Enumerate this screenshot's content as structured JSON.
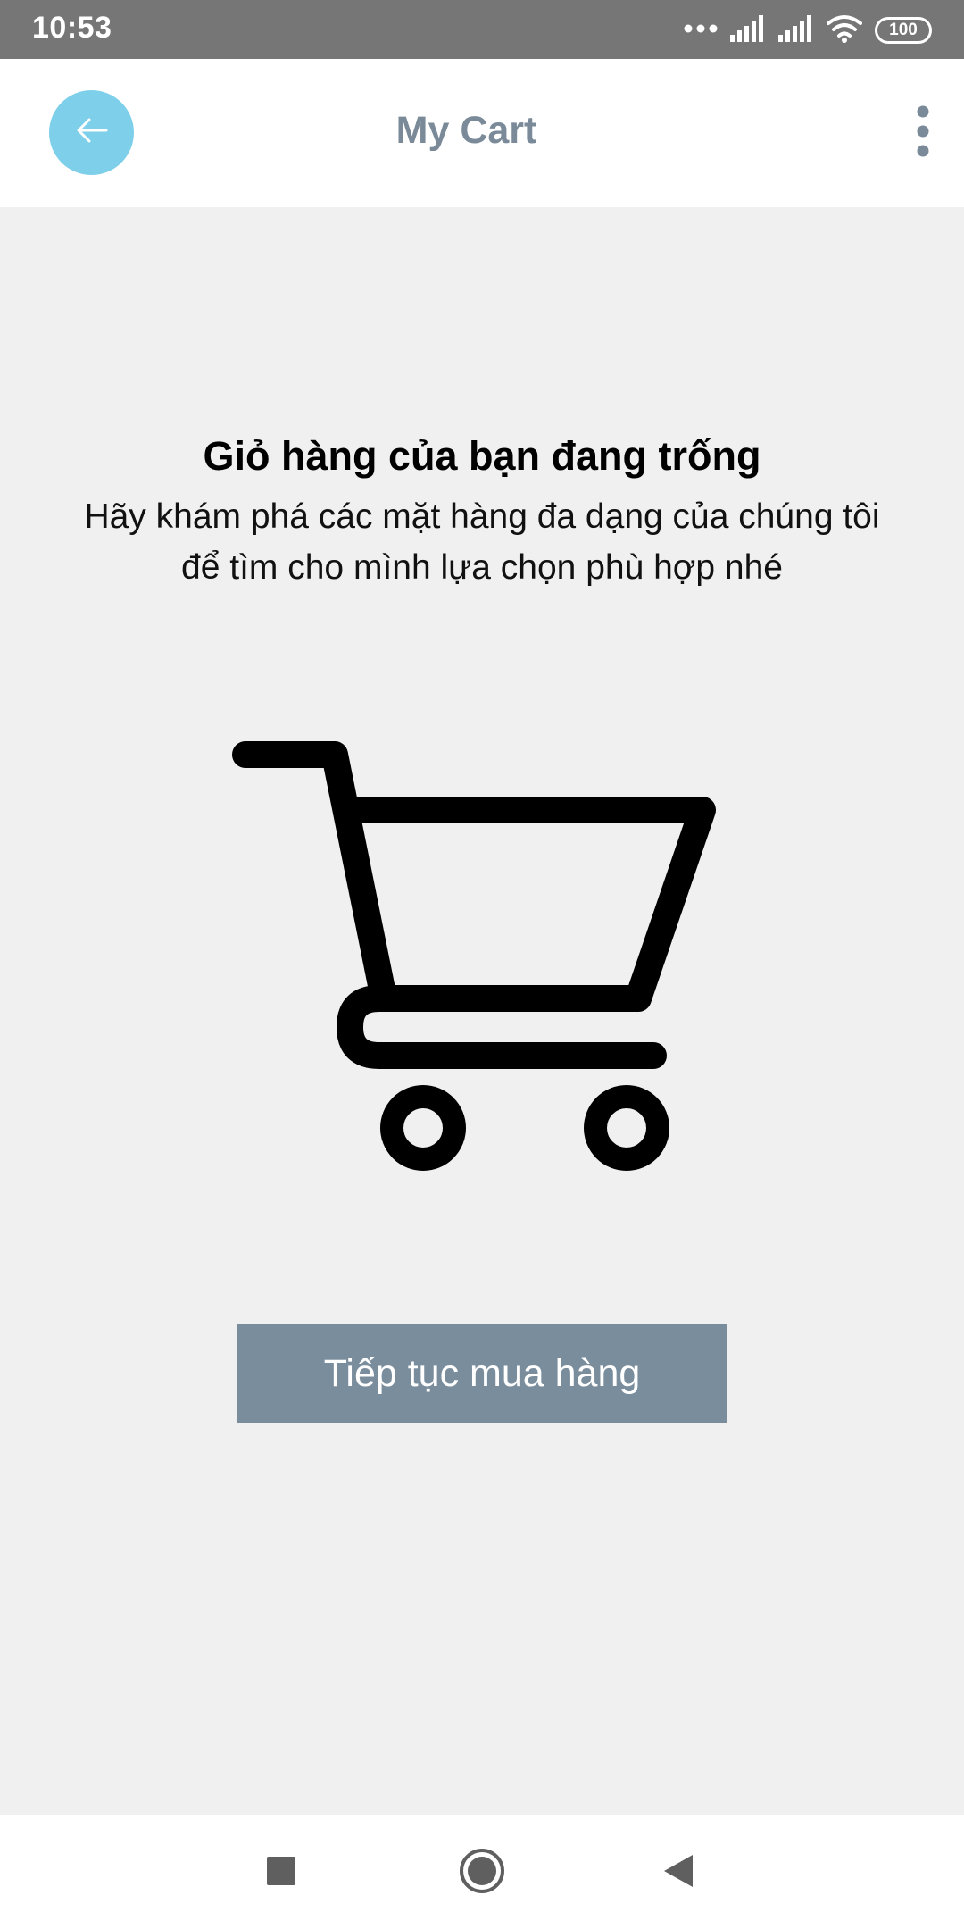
{
  "status_bar": {
    "time": "10:53",
    "battery": "100",
    "icons": [
      "dots-icon",
      "signal-icon",
      "signal-icon",
      "wifi-icon",
      "battery-icon"
    ]
  },
  "header": {
    "title": "My Cart",
    "back_icon": "arrow-left-icon",
    "menu_icon": "more-vertical-icon"
  },
  "empty_state": {
    "title": "Giỏ hàng của bạn đang trống",
    "line1": "Hãy khám phá các mặt hàng đa dạng của chúng tôi",
    "line2": "để tìm cho mình lựa chọn phù hợp nhé",
    "illustration_icon": "shopping-cart-icon"
  },
  "actions": {
    "continue_label": "Tiếp tục mua hàng"
  },
  "nav_bar": {
    "icons": [
      "square-icon",
      "circle-icon",
      "triangle-back-icon"
    ]
  },
  "colors": {
    "status_bar": "#767676",
    "accent": "#7dcfea",
    "title": "#7a8a99",
    "button": "#7a8d9d",
    "background": "#f0f0f1"
  }
}
